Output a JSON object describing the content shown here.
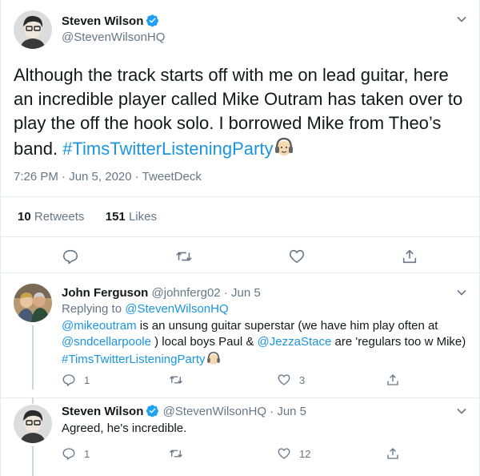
{
  "main_tweet": {
    "display_name": "Steven Wilson",
    "handle": "@StevenWilsonHQ",
    "text_before": "Although the track starts off with me on lead guitar, here an incredible player called Mike Outram has taken over to play the off the hook solo. I borrowed Mike from Theo’s band. ",
    "hashtag": "#TimsTwitterListeningParty",
    "time": "7:26 PM · Jun 5, 2020 · ",
    "source": "TweetDeck",
    "retweets_count": "10",
    "retweets_label": "Retweets",
    "likes_count": "151",
    "likes_label": "Likes"
  },
  "reply_1": {
    "display_name": "John Ferguson",
    "handle": "@johnferg02",
    "date": "· Jun 5",
    "replying_label": "Replying to ",
    "replying_to": "@StevenWilsonHQ",
    "mention_1": "@mikeoutram",
    "text_1": " is an unsung guitar superstar (we have him play often at ",
    "mention_2": "@sndcellarpoole",
    "text_2": " ) local boys Paul & ",
    "mention_3": "@JezzaStace",
    "text_3": " are 'regulars too w Mike) ",
    "hashtag": "#TimsTwitterListeningParty",
    "reply_count": "1",
    "retweet_count": "",
    "like_count": "3"
  },
  "reply_2": {
    "display_name": "Steven Wilson",
    "handle": "@StevenWilsonHQ",
    "date": "· Jun 5",
    "text": "Agreed, he's incredible.",
    "reply_count": "1",
    "retweet_count": "",
    "like_count": "12"
  },
  "colors": {
    "accent": "#1b95e0",
    "verified": "#1da1f2",
    "muted": "#657786",
    "divider": "#e6ecf0"
  },
  "icons": [
    "chevron-down-icon",
    "verified-icon",
    "reply-icon",
    "retweet-icon",
    "like-icon",
    "share-icon",
    "headphones-emoji"
  ]
}
